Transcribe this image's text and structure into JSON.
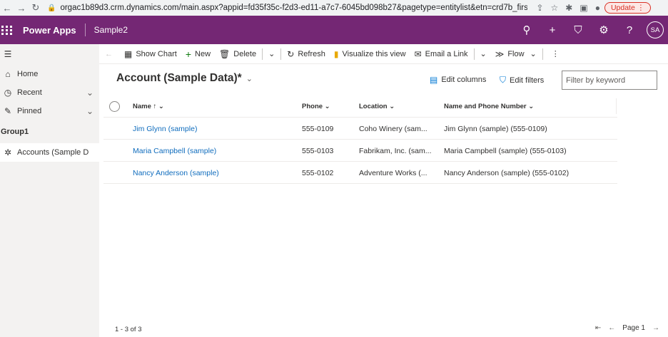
{
  "browser": {
    "url": "orgac1b89d3.crm.dynamics.com/main.aspx?appid=fd35f35c-f2d3-ed11-a7c7-6045bd098b27&pagetype=entitylist&etn=crd7b_firstruntourt...",
    "update_label": "Update"
  },
  "app": {
    "name": "Power Apps",
    "environment": "Sample2",
    "avatar_initials": "SA"
  },
  "sidebar": {
    "home": "Home",
    "recent": "Recent",
    "pinned": "Pinned",
    "group_label": "Group1",
    "accounts": "Accounts (Sample D..."
  },
  "commands": {
    "show_chart": "Show Chart",
    "new": "New",
    "delete": "Delete",
    "refresh": "Refresh",
    "visualize": "Visualize this view",
    "email_link": "Email a Link",
    "flow": "Flow"
  },
  "view": {
    "title": "Account (Sample Data)*",
    "edit_columns": "Edit columns",
    "edit_filters": "Edit filters",
    "filter_placeholder": "Filter by keyword"
  },
  "grid": {
    "columns": [
      "Name",
      "Phone",
      "Location",
      "Name and Phone Number"
    ],
    "rows": [
      {
        "name": "Jim Glynn (sample)",
        "phone": "555-0109",
        "location": "Coho Winery (sam...",
        "name_phone": "Jim Glynn (sample) (555-0109)"
      },
      {
        "name": "Maria Campbell (sample)",
        "phone": "555-0103",
        "location": "Fabrikam, Inc. (sam...",
        "name_phone": "Maria Campbell (sample) (555-0103)"
      },
      {
        "name": "Nancy Anderson (sample)",
        "phone": "555-0102",
        "location": "Adventure Works (...",
        "name_phone": "Nancy Anderson (sample) (555-0102)"
      }
    ]
  },
  "footer": {
    "count": "1 - 3 of 3",
    "page": "Page 1"
  },
  "colors": {
    "appbar": "#742774",
    "link": "#0f6cbd",
    "accent": "#0078d4"
  }
}
